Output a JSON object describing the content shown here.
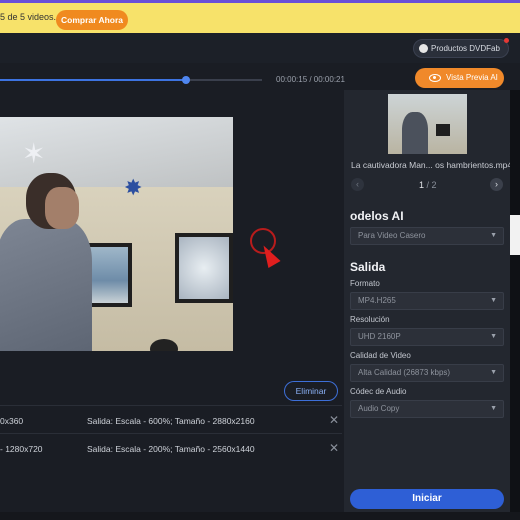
{
  "banner": {
    "text": "5 de 5 videos.",
    "buy_label": "Comprar Ahora",
    "bg_color": "#f7e26a",
    "buy_color": "#f08a1f"
  },
  "header": {
    "products_label": "Productos DVDFab"
  },
  "player": {
    "time": "00:00:15 / 00:00:21",
    "progress_fraction": 0.71,
    "preview_label": "Vista Previa AI"
  },
  "list": {
    "delete_label": "Eliminar",
    "rows": [
      {
        "input": "0x360",
        "output": "Salida: Escala - 600%; Tamaño - 2880x2160"
      },
      {
        "input": "- 1280x720",
        "output": "Salida: Escala - 200%; Tamaño - 2560x1440"
      }
    ]
  },
  "panel": {
    "filename": "La cautivadora Man... os hambrientos.mp4",
    "page_current": "1",
    "page_total": "/ 2",
    "models_title": "odelos AI",
    "model_value": "Para Video Casero",
    "output_title": "Salida",
    "format_label": "Formato",
    "format_value": "MP4.H265",
    "resolution_label": "Resolución",
    "resolution_value": "UHD 2160P",
    "quality_label": "Calidad de Video",
    "quality_value": "Alta Calidad (26873 kbps)",
    "audio_label": "Códec de Audio",
    "audio_value": "Audio Copy",
    "start_label": "Iniciar",
    "accent_color": "#2e5fd6"
  }
}
